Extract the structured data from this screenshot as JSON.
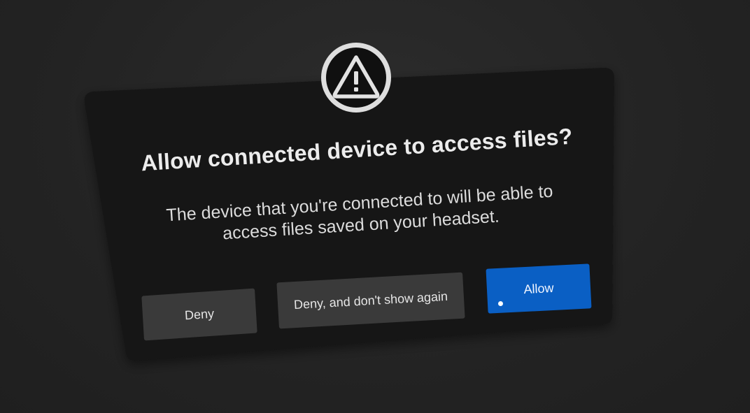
{
  "dialog": {
    "icon": "warning-icon",
    "title": "Allow connected device to access files?",
    "message": "The device that you're connected to will be able to access files saved on your headset.",
    "buttons": {
      "deny": "Deny",
      "deny_forever": "Deny, and don't show again",
      "allow": "Allow"
    }
  },
  "colors": {
    "background": "#262626",
    "panel": "#151515",
    "secondary_button": "#3a3a3a",
    "primary_button": "#0a5fc4",
    "text": "#ececec"
  }
}
